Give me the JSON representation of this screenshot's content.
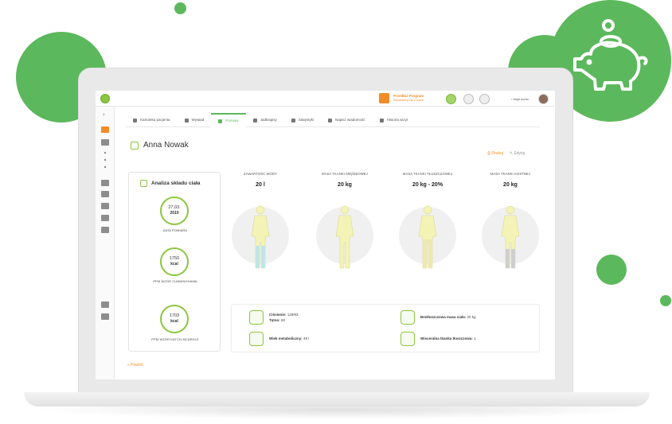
{
  "colors": {
    "accent": "#5cb85c",
    "orange": "#f28c28",
    "lime": "#8cc63f"
  },
  "topbar": {
    "promo_title": "Przedłuż Program",
    "promo_sub": "Skontaktuj się z nami",
    "account_label": "Moje konto"
  },
  "tabs": [
    {
      "label": "Kartoteka pacjenta",
      "icon": "folder-icon"
    },
    {
      "label": "Wywiad",
      "icon": "pencil-icon"
    },
    {
      "label": "Pomiary",
      "icon": "clipboard-icon"
    },
    {
      "label": "Jadłospisy",
      "icon": "plate-icon"
    },
    {
      "label": "Statystyki",
      "icon": "chart-icon"
    },
    {
      "label": "Napisz wiadomość",
      "icon": "mail-icon"
    },
    {
      "label": "Historia wizyt",
      "icon": "clock-icon"
    }
  ],
  "patient": {
    "name": "Anna Nowak"
  },
  "actions": {
    "print": "Drukuj",
    "edit": "Edytuj"
  },
  "panel": {
    "title": "Analiza składu ciała",
    "date_value": "27.03.",
    "date_year": "2019",
    "date_caption": "DATA POMIARU",
    "ppm1_value": "1750",
    "ppm1_unit": "kcal",
    "ppm1_caption": "PPM WZÓR CUNNINGHAMA",
    "ppm2_value": "1703",
    "ppm2_unit": "kcal",
    "ppm2_caption": "PPM WZÓR KATCH-MCARDLE"
  },
  "body_metrics": [
    {
      "label": "ZAWARTOŚĆ WODY",
      "value": "20 l"
    },
    {
      "label": "MASA TKANKI MIĘŚNIOWEJ",
      "value": "20 kg"
    },
    {
      "label": "MASA TKANKI TŁUSZCZOWEJ",
      "value": "20 kg - 20%"
    },
    {
      "label": "MASA TKANKI KOSTNEJ",
      "value": "20 kg"
    }
  ],
  "stats": {
    "pressure_label": "Ciśnienie:",
    "pressure_value": "129/93",
    "pulse_label": "Tętno:",
    "pulse_value": "80",
    "lean_label": "Beztłuszczowa masa ciała:",
    "lean_value": "20 kg",
    "meta_label": "Wiek metaboliczny:",
    "meta_value": "49 l",
    "visceral_label": "Wisceralna tkanka tłuszczowa:",
    "visceral_value": "1"
  },
  "back_label": "« Powrót"
}
